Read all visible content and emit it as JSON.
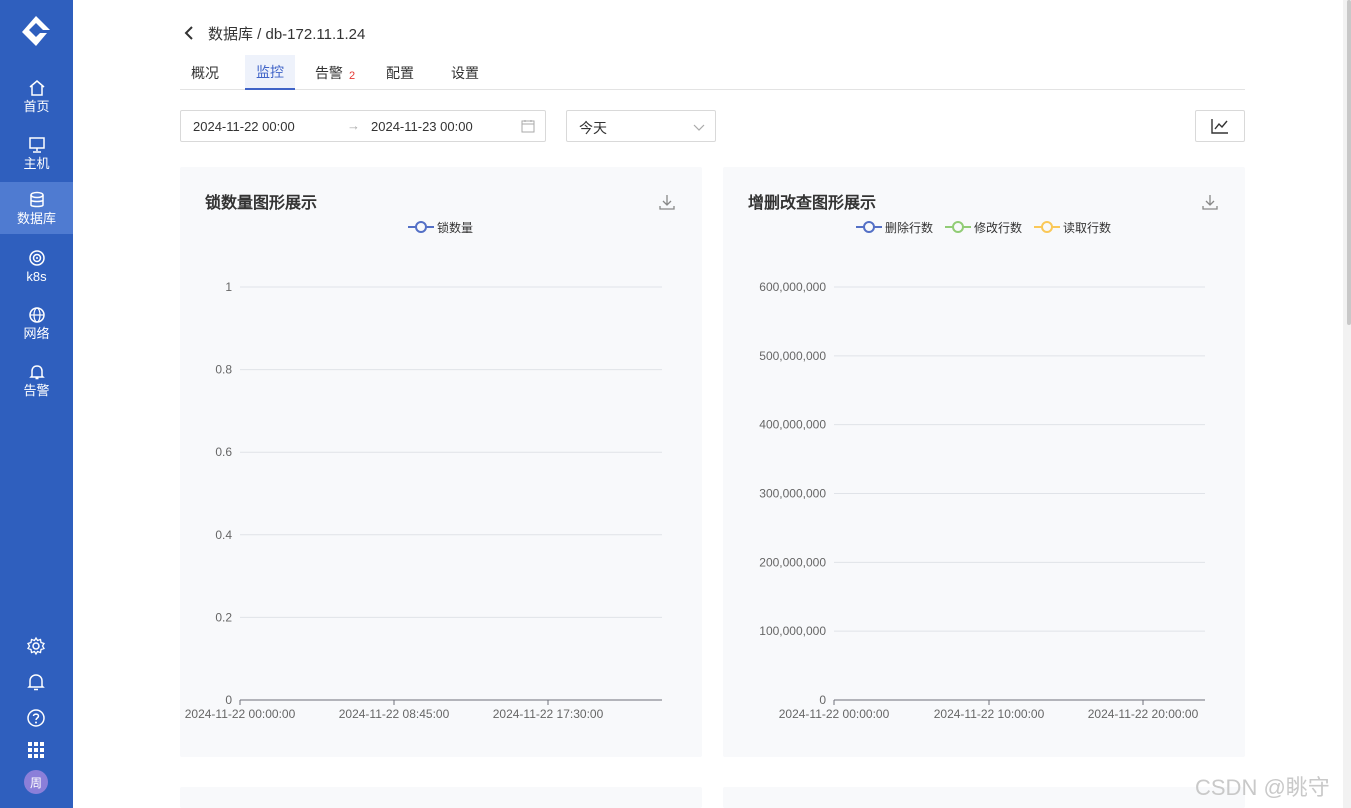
{
  "sidebar": {
    "items": [
      {
        "label": "首页",
        "icon": "home-icon"
      },
      {
        "label": "主机",
        "icon": "monitor-icon"
      },
      {
        "label": "数据库",
        "icon": "database-icon"
      },
      {
        "label": "k8s",
        "icon": "k8s-icon"
      },
      {
        "label": "网络",
        "icon": "globe-icon"
      },
      {
        "label": "告警",
        "icon": "bell-icon"
      }
    ],
    "active_index": 2,
    "bottom_icons": [
      "gear-icon",
      "bell-icon",
      "help-icon",
      "grid-icon"
    ],
    "avatar": "周",
    "bg_color": "#2f5fbe"
  },
  "header": {
    "breadcrumb": "数据库 / db-172.11.1.24"
  },
  "tabs": [
    {
      "label": "概况"
    },
    {
      "label": "监控",
      "active": true
    },
    {
      "label": "告警",
      "badge": "2"
    },
    {
      "label": "配置"
    },
    {
      "label": "设置"
    }
  ],
  "filters": {
    "date_start": "2024-11-22 00:00",
    "date_arrow": "→",
    "date_end": "2024-11-23 00:00",
    "range_select": "今天"
  },
  "chart_data": [
    {
      "type": "line",
      "title": "锁数量图形展示",
      "series": [
        {
          "name": "锁数量",
          "color": "#5470c6",
          "values": []
        }
      ],
      "y_ticks": [
        "0",
        "0.2",
        "0.4",
        "0.6",
        "0.8",
        "1"
      ],
      "x_ticks": [
        "2024-11-22 00:00:00",
        "2024-11-22 08:45:00",
        "2024-11-22 17:30:00"
      ],
      "ylim": [
        0,
        1
      ],
      "grid": true
    },
    {
      "type": "line",
      "title": "增删改查图形展示",
      "series": [
        {
          "name": "删除行数",
          "color": "#5470c6",
          "values": []
        },
        {
          "name": "修改行数",
          "color": "#91cc75",
          "values": []
        },
        {
          "name": "读取行数",
          "color": "#fac858",
          "values": []
        }
      ],
      "y_ticks": [
        "0",
        "100,000,000",
        "200,000,000",
        "300,000,000",
        "400,000,000",
        "500,000,000",
        "600,000,000"
      ],
      "x_ticks": [
        "2024-11-22 00:00:00",
        "2024-11-22 10:00:00",
        "2024-11-22 20:00:00"
      ],
      "ylim": [
        0,
        600000000
      ],
      "grid": true
    }
  ],
  "watermark": "CSDN @眺守"
}
